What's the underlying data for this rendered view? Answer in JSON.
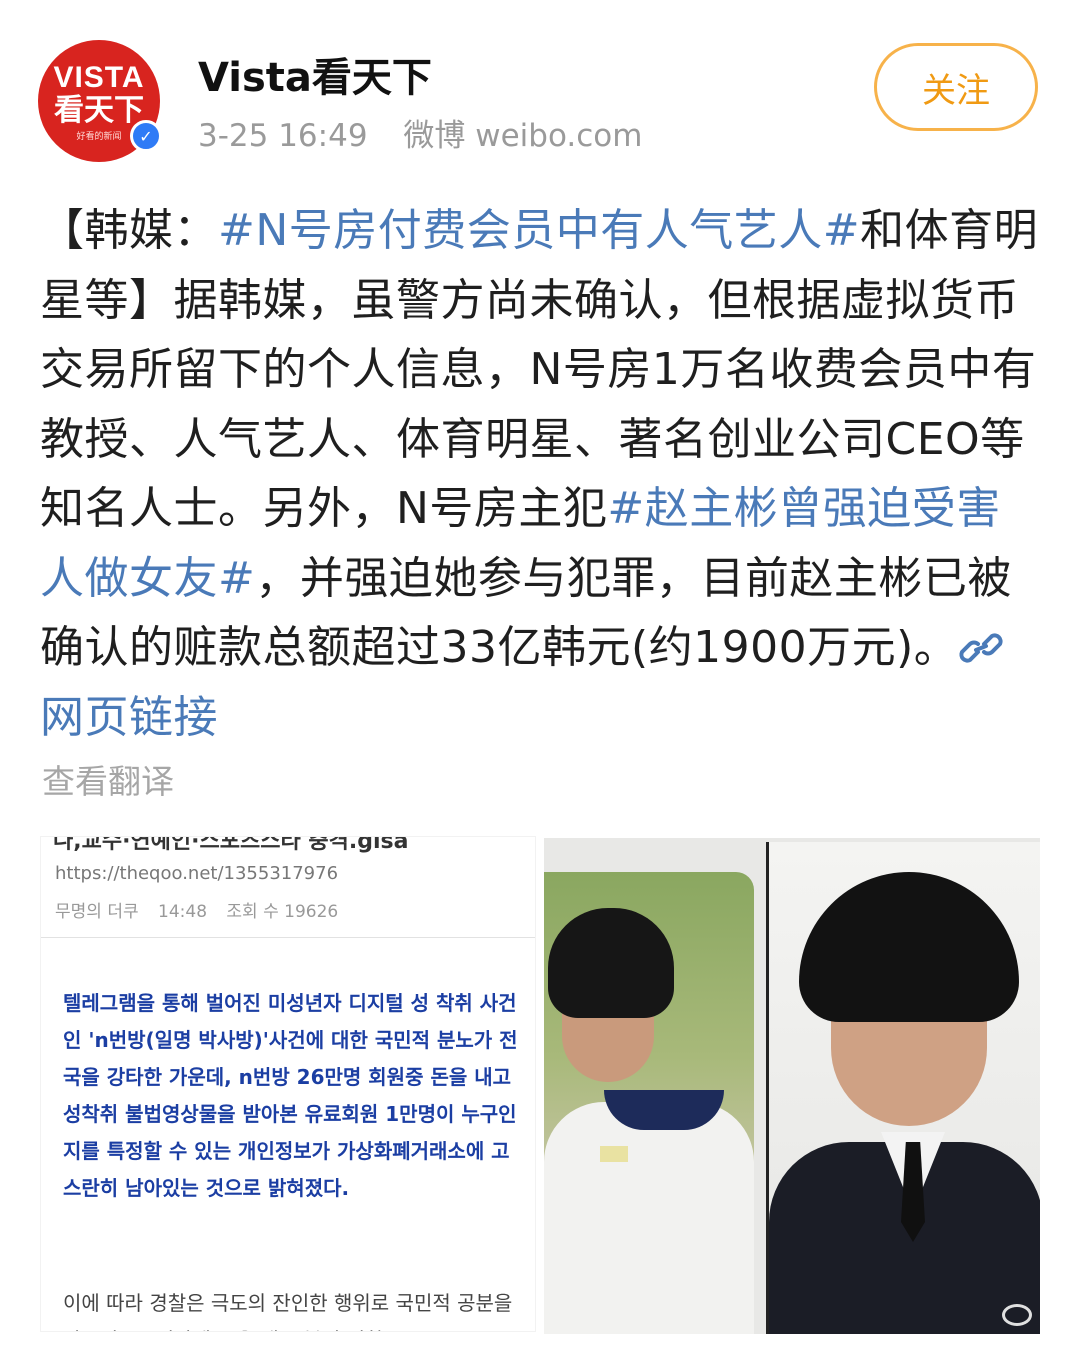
{
  "header": {
    "avatar": {
      "line1": "VISTA",
      "line2": "看天下",
      "line3": "好看的新闻"
    },
    "verified_icon": "verified-badge-icon",
    "username": "Vista看天下",
    "time": "3-25 16:49",
    "source": "微博 weibo.com",
    "follow_label": "关注"
  },
  "post": {
    "t1": "【韩媒：",
    "topic1": "#N号房付费会员中有人气艺人#",
    "t2": "和体育明星等】据韩媒，虽警方尚未确认，但根据虚拟货币交易所留下的个人信息，N号房1万名收费会员中有教授、人气艺人、体育明星、著名创业公司CEO等知名人士。另外，N号房主犯",
    "topic2": "#赵主彬曾强迫受害人做女友#",
    "t3": "，并强迫她参与犯罪，目前赵主彬已被确认的赃款总额超过33亿韩元(约1900万元)。",
    "link_label": "网页链接",
    "translate_label": "查看翻译"
  },
  "images": {
    "left": {
      "cut_title": "나,교수·연예인·스포츠스타 충격.gisa",
      "url": "https://theqoo.net/1355317976",
      "author": "무명의 더쿠",
      "time": "14:48",
      "views": "조회 수 19626",
      "highlight": "텔레그램을 통해 벌어진 미성년자 디지털 성 착취 사건인 'n번방(일명 박사방)'사건에 대한 국민적 분노가 전국을 강타한 가운데, n번방 26만명 회원중 돈을 내고 성착취 불법영상물을 받아본 유료회원 1만명이 누구인지를 특정할 수 있는 개인정보가 가상화폐거래소에 고스란히 남아있는 것으로 밝혀졌다.",
      "body2": "이에 따라 경찰은 극도의 잔인한 행위로 국민적 공분을 사고있는 n번방에 돈을 내고 불법 성착"
    }
  },
  "colors": {
    "accent": "#f09a13",
    "topic": "#4a7ab8",
    "brand": "#d8241f",
    "article_blue": "#1b3ea3"
  }
}
